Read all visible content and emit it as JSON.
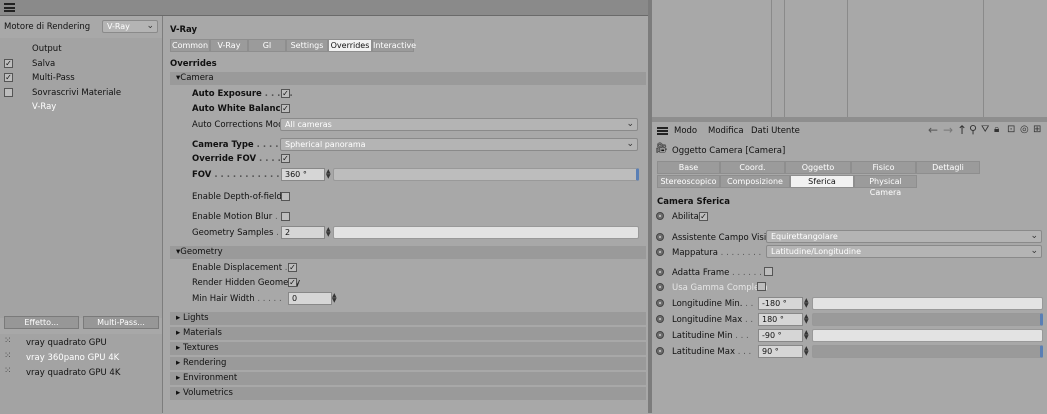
{
  "left": {
    "renderer_label": "Motore di Rendering",
    "renderer_value": "V-Ray",
    "tree": [
      {
        "label": "Output",
        "checked": false,
        "checkbox": false
      },
      {
        "label": "Salva",
        "checked": true,
        "checkbox": true
      },
      {
        "label": "Multi-Pass",
        "checked": true,
        "checkbox": true
      },
      {
        "label": "Sovrascrivi Materiale",
        "checked": false,
        "checkbox": true
      },
      {
        "label": "V-Ray",
        "checked": false,
        "checkbox": false
      }
    ],
    "effect_button": "Effetto...",
    "multipass_button": "Multi-Pass...",
    "presets": [
      "vray quadrato GPU",
      "vray 360pano GPU 4K",
      "vray quadrato GPU 4K"
    ]
  },
  "vray": {
    "title": "V-Ray",
    "tabs": [
      "Common",
      "V-Ray",
      "GI",
      "Settings",
      "Overrides",
      "Interactive"
    ],
    "active_tab": "Overrides",
    "heading": "Overrides",
    "camera_section": "Camera",
    "auto_exposure": "Auto Exposure",
    "auto_white_balance": "Auto White Balance",
    "auto_corrections_mode": "Auto Corrections Mode",
    "auto_corrections_value": "All cameras",
    "camera_type": "Camera Type",
    "camera_type_value": "Spherical panorama",
    "override_fov": "Override FOV",
    "fov": "FOV",
    "fov_value": "360 °",
    "enable_dof": "Enable Depth-of-field",
    "enable_motion_blur": "Enable Motion Blur",
    "geometry_samples": "Geometry Samples",
    "geometry_samples_value": "2",
    "geometry_section": "Geometry",
    "enable_displacement": "Enable Displacement",
    "render_hidden_geometry": "Render Hidden Geometry",
    "min_hair_width": "Min Hair Width",
    "min_hair_width_value": "0",
    "collapsed_sections": [
      "Lights",
      "Materials",
      "Textures",
      "Rendering",
      "Environment",
      "Volumetrics"
    ]
  },
  "attr": {
    "menu": [
      "Modo",
      "Modifica",
      "Dati Utente"
    ],
    "object_title": "Oggetto Camera [Camera]",
    "tabs_row1": [
      "Base",
      "Coord.",
      "Oggetto",
      "Fisico",
      "Dettagli"
    ],
    "tabs_row2": [
      "Stereoscopico",
      "Composizione",
      "Sferica",
      "Physical Camera"
    ],
    "active_tab": "Sferica",
    "section": "Camera Sferica",
    "abilita": "Abilita",
    "assist_label": "Assistente Campo Visivo",
    "assist_value": "Equirettangolare",
    "mapping_label": "Mappatura",
    "mapping_value": "Latitudine/Longitudine",
    "fit_frame": "Adatta Frame",
    "full_range": "Usa Gamma Completa",
    "lon_min": "Longitudine Min.",
    "lon_min_value": "-180 °",
    "lon_max": "Longitudine Max",
    "lon_max_value": "180 °",
    "lat_min": "Latitudine Min",
    "lat_min_value": "-90 °",
    "lat_max": "Latitudine Max",
    "lat_max_value": "90 °"
  }
}
